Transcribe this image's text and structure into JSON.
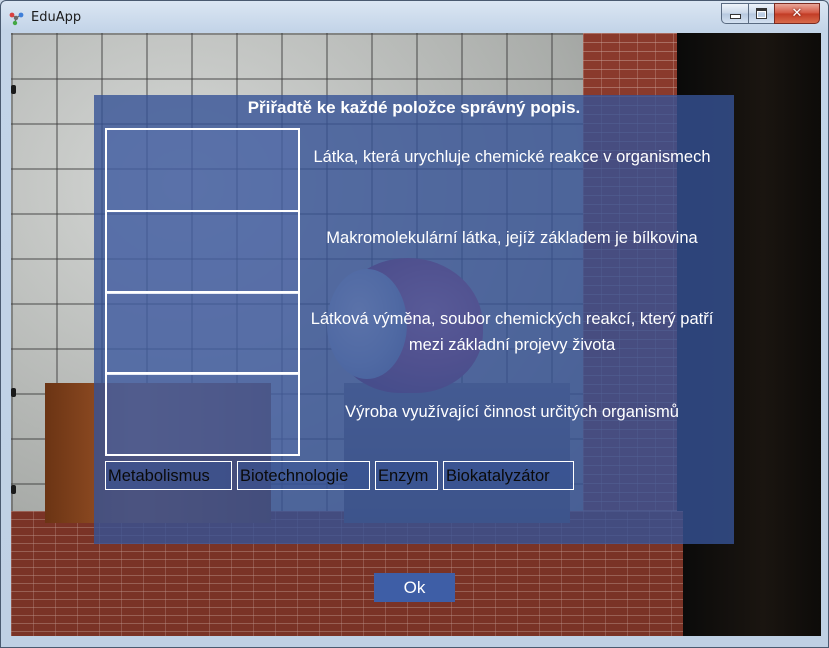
{
  "window": {
    "title": "EduApp",
    "icon": "molecule-icon",
    "controls": {
      "minimize": "minimize-icon",
      "maximize": "maximize-icon",
      "close": "✕"
    }
  },
  "quiz": {
    "instruction": "Přiřadtě ke každé položce správný popis.",
    "descriptions": [
      "Látka, která urychluje chemické reakce v organismech",
      "Makromolekulární látka, jejíž základem je bílkovina",
      "Látková výměna, soubor chemických reakcí, který patří mezi základní projevy života",
      "Výroba využívající činnost určitých organismů"
    ],
    "answers": [
      "Metabolismus",
      "Biotechnologie",
      "Enzym",
      "Biokatalyzátor"
    ],
    "ok_label": "Ok"
  },
  "colors": {
    "overlay": "#36529680",
    "ok_button": "#3e5ea6",
    "close_button": "#c13b24"
  }
}
